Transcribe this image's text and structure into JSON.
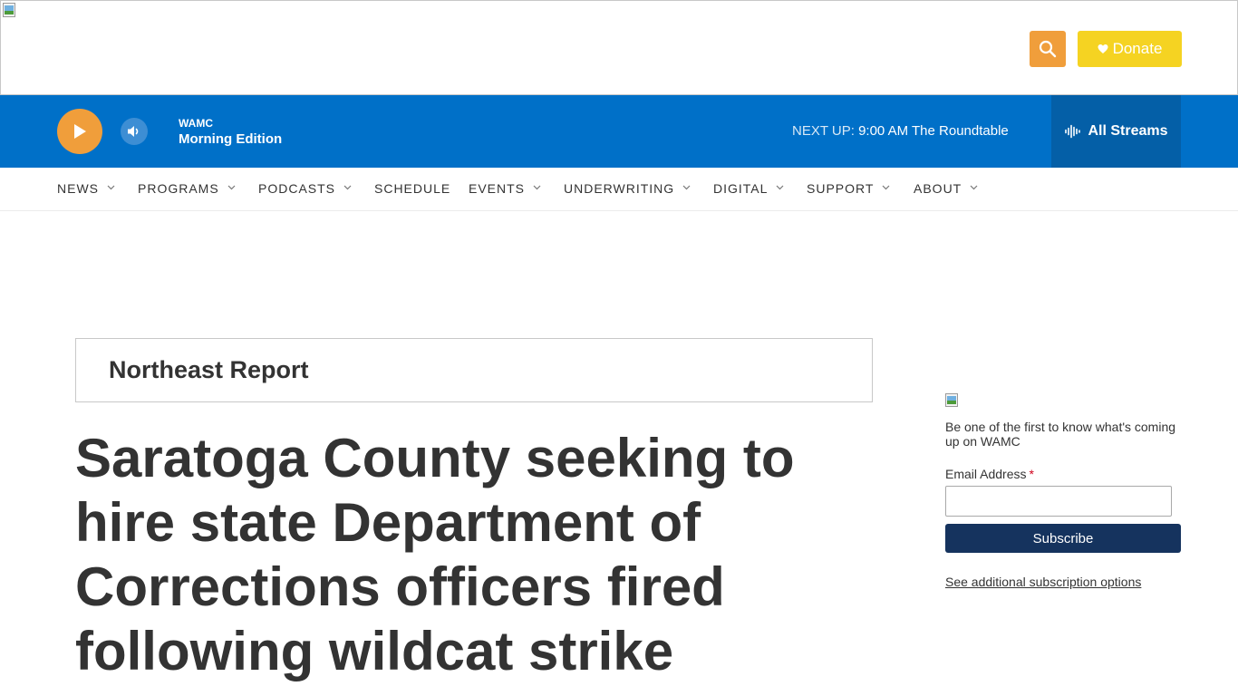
{
  "header": {
    "donate_label": "Donate",
    "colors": {
      "search_bg": "#f09e3b",
      "donate_bg": "#f5d322"
    }
  },
  "player": {
    "station": "WAMC",
    "program": "Morning Edition",
    "next_up_label": "NEXT UP:",
    "next_up_value": "9:00 AM The Roundtable",
    "all_streams_label": "All Streams",
    "colors": {
      "bar_bg": "#0070c8",
      "streams_bg": "#045fa7",
      "play_bg": "#f09e3b"
    }
  },
  "nav": {
    "items": [
      {
        "label": "NEWS",
        "dropdown": true
      },
      {
        "label": "PROGRAMS",
        "dropdown": true
      },
      {
        "label": "PODCASTS",
        "dropdown": true
      },
      {
        "label": "SCHEDULE",
        "dropdown": false
      },
      {
        "label": "EVENTS",
        "dropdown": true
      },
      {
        "label": "UNDERWRITING",
        "dropdown": true
      },
      {
        "label": "DIGITAL",
        "dropdown": true
      },
      {
        "label": "SUPPORT",
        "dropdown": true
      },
      {
        "label": "ABOUT",
        "dropdown": true
      }
    ]
  },
  "article": {
    "tag": "Northeast Report",
    "headline": "Saratoga County seeking to hire state Department of Corrections officers fired following wildcat strike"
  },
  "sidebar": {
    "newsletter_text": "Be one of the first to know what's coming up on WAMC",
    "email_label": "Email Address",
    "required_mark": "*",
    "email_value": "",
    "subscribe_label": "Subscribe",
    "more_options_label": "See additional subscription options",
    "colors": {
      "subscribe_bg": "#15335e"
    }
  },
  "icons": [
    "broken-image-icon",
    "search-icon",
    "heart-icon",
    "play-icon",
    "volume-icon",
    "audio-wave-icon",
    "chevron-down-icon"
  ]
}
